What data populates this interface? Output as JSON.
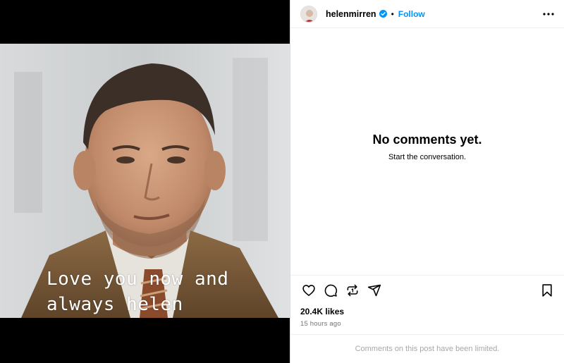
{
  "media": {
    "caption_line1": "Love you now and",
    "caption_line2": "always helen"
  },
  "header": {
    "username": "helenmirren",
    "separator": "•",
    "follow_label": "Follow"
  },
  "comments": {
    "empty_title": "No comments yet.",
    "empty_subtitle": "Start the conversation."
  },
  "stats": {
    "likes": "20.4K likes",
    "time_ago": "15 hours ago"
  },
  "footer": {
    "limited_notice": "Comments on this post have been limited."
  },
  "icons": [
    "heart-icon",
    "comment-icon",
    "repost-icon",
    "share-icon",
    "bookmark-icon",
    "more-icon",
    "verified-badge-icon"
  ],
  "colors": {
    "follow": "#0095f6",
    "verified": "#0095f6",
    "muted": "#737373",
    "border": "#dbdbdb"
  }
}
